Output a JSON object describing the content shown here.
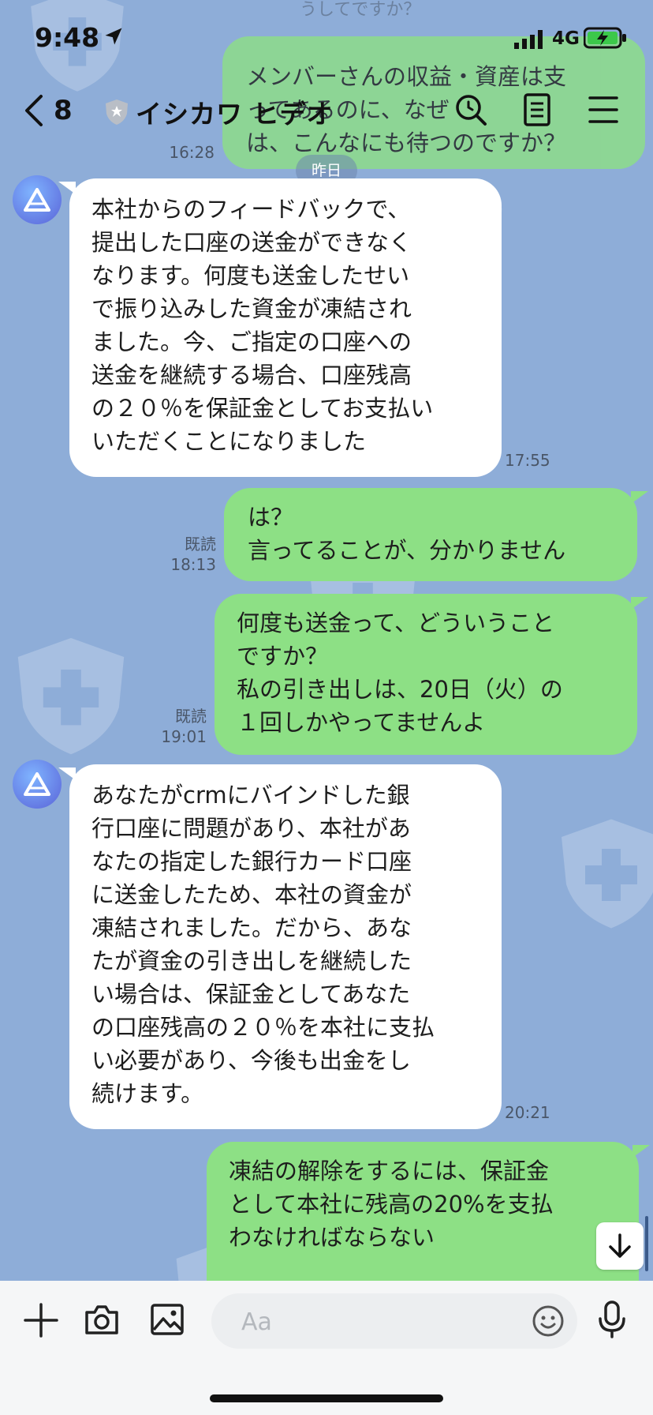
{
  "status_bar": {
    "time": "9:48",
    "network": "4G"
  },
  "header": {
    "back_count": "8",
    "title": "イシカワ ヒデオ"
  },
  "icons": {
    "back": "chevron-left-icon",
    "search": "search-icon",
    "notes": "notes-icon",
    "menu": "menu-icon",
    "plus": "plus-icon",
    "camera": "camera-icon",
    "image": "image-icon",
    "emoji": "emoji-icon",
    "mic": "microphone-icon"
  },
  "chat": {
    "top_partial": {
      "out_text": "メンバーさんの収益・資産は支\nってあるのに、なぜ\nは、こんなにも待つのですか？",
      "out_time": "16:28",
      "faded_top": "うしてですか？"
    },
    "day_divider": "昨日",
    "messages": [
      {
        "side": "in",
        "text": "本社からのフィードバックで、\n提出した口座の送金ができなく\nなります。何度も送金したせい\nで振り込みした資金が凍結され\nました。今、ご指定の口座への\n送金を継続する場合、口座残高\nの２０％を保証金としてお支払い\nいただくことになりました",
        "time": "17:55"
      },
      {
        "side": "out",
        "text": "は？\n言ってることが、分かりません",
        "read": "既読",
        "time": "18:13"
      },
      {
        "side": "out",
        "text": "何度も送金って、どういうこと\nですか？\n私の引き出しは、20日（火）の\n１回しかやってませんよ",
        "read": "既読",
        "time": "19:01"
      },
      {
        "side": "in",
        "text": "あなたがcrmにバインドした銀\n行口座に問題があり、本社があ\nなたの指定した銀行カード口座\nに送金したため、本社の資金が\n凍結されました。だから、あな\nたが資金の引き出しを継続した\nい場合は、保証金としてあなた\nの口座残高の２０％を本社に支払\nい必要があり、今後も出金をし\n続けます。",
        "time": "20:21"
      },
      {
        "side": "out",
        "text": "凍結の解除をするには、保証金\nとして本社に残高の20%を支払\nわなければならない"
      }
    ]
  },
  "composer": {
    "placeholder": "Aa"
  },
  "colors": {
    "background": "#8eadd8",
    "out_bubble": "#8de085",
    "in_bubble": "#ffffff"
  }
}
